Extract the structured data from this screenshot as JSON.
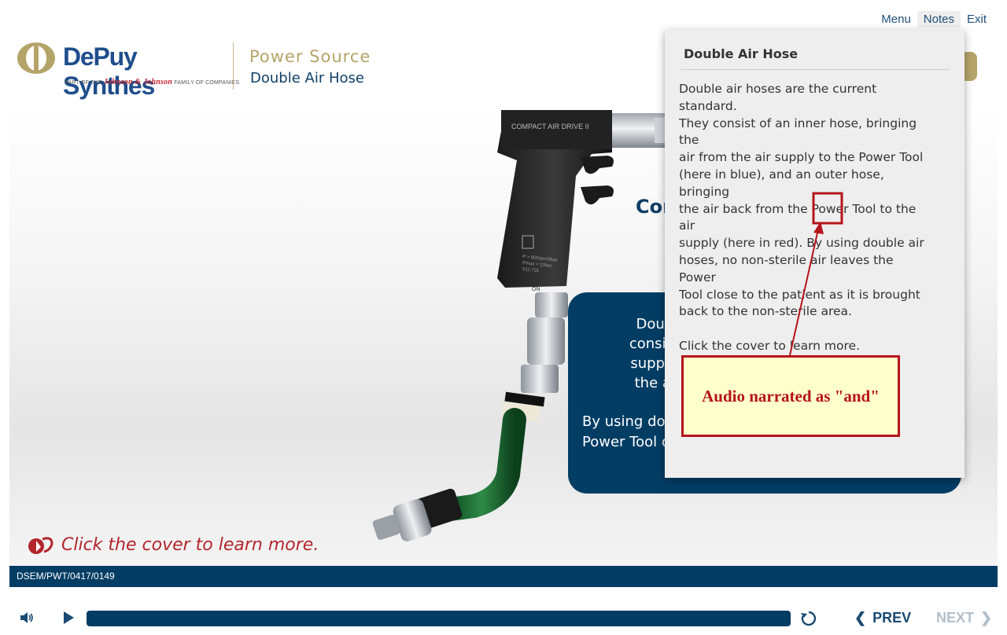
{
  "topnav": {
    "menu": "Menu",
    "notes": "Notes",
    "exit": "Exit"
  },
  "logo": {
    "wordmark": "DePuy Synthes",
    "tagline_prefix": "PART OF THE",
    "tagline_brand": "Johnson & Johnson",
    "tagline_suffix": "FAMILY OF COMPANIES"
  },
  "header": {
    "section": "Power Source",
    "title": "Double Air Hose"
  },
  "tool": {
    "brand_label": "COMPACT AIR DRIVE II",
    "spec_line1": "P = 900rpm/8bar",
    "spec_line2": "Pmax = 10bar",
    "spec_line3": "511.701",
    "on_label": "ON"
  },
  "content": {
    "heading": "Cor",
    "panel_lines": [
      "Double air",
      "consist of ar",
      "supply to th",
      "the air bac"
    ],
    "panel_lines2": [
      "By using dou",
      "Power Tool c"
    ],
    "learn_more": "Click the cover to learn more."
  },
  "notes": {
    "title": "Double Air Hose",
    "lines": [
      "Double air hoses are the current standard.",
      "They consist of an inner hose, bringing the",
      "air from the air supply to the Power Tool",
      "(here in blue), and an outer hose, bringing",
      "the air back from the Power Tool to the air",
      "supply (here in red). By using double air",
      "hoses, no non-sterile air leaves the Power",
      "Tool close to the patient as it is brought",
      "back to the non-sterile area."
    ],
    "cta": "Click the cover to learn more."
  },
  "annotation": {
    "text": "Audio narrated as \"and\""
  },
  "footer": {
    "code": "DSEM/PWT/0417/0149"
  },
  "player": {
    "prev": "PREV",
    "next": "NEXT",
    "progress": 1.0
  },
  "colors": {
    "navy": "#033d64",
    "gold": "#b5a46a",
    "brand_blue": "#1f4e8c",
    "accent_red": "#b3262e",
    "annotation_red": "#b5141b"
  }
}
